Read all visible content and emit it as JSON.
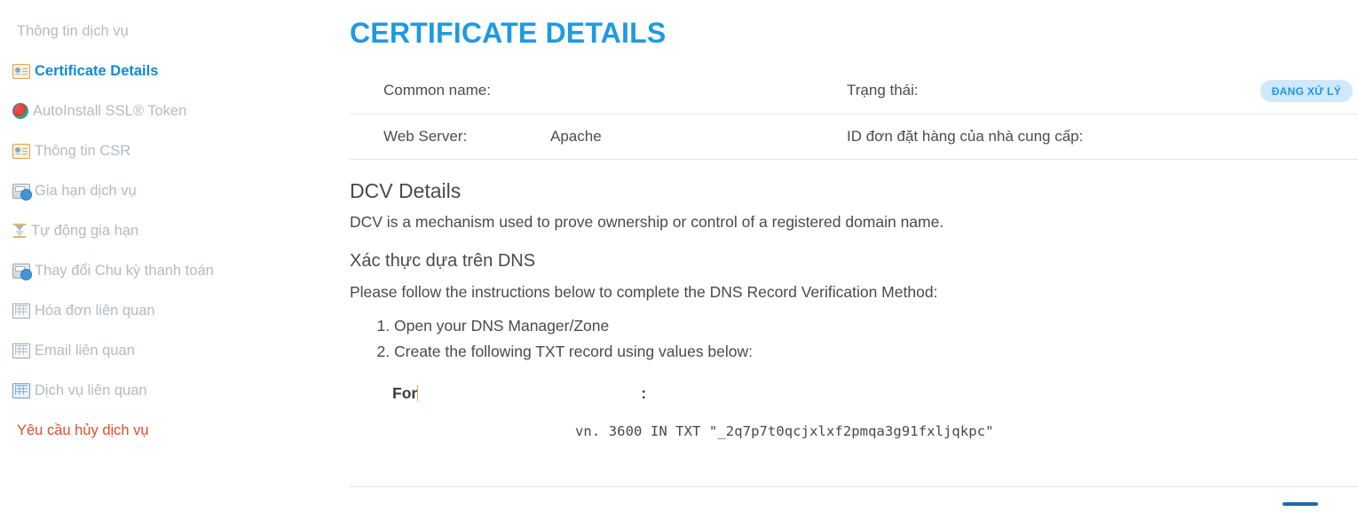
{
  "sidebar": {
    "items": [
      {
        "label": "Thông tin dịch vụ",
        "icon": "none",
        "state": "plain"
      },
      {
        "label": "Certificate Details",
        "icon": "certificate-card-icon",
        "state": "active"
      },
      {
        "label": "AutoInstall SSL® Token",
        "icon": "autoinstall-token-icon",
        "state": "normal"
      },
      {
        "label": "Thông tin CSR",
        "icon": "certificate-card-icon",
        "state": "normal"
      },
      {
        "label": "Gia hạn dịch vụ",
        "icon": "renew-icon",
        "state": "normal"
      },
      {
        "label": "Tự động gia hạn",
        "icon": "hourglass-icon",
        "state": "normal"
      },
      {
        "label": "Thay đổi Chu kỳ thanh toán",
        "icon": "renew-icon",
        "state": "normal"
      },
      {
        "label": "Hóa đơn liên quan",
        "icon": "grid-icon",
        "state": "normal"
      },
      {
        "label": "Email liên quan",
        "icon": "grid-icon",
        "state": "normal"
      },
      {
        "label": "Dịch vụ liên quan",
        "icon": "grid-blue-icon",
        "state": "normal"
      },
      {
        "label": "Yêu cầu hủy dịch vụ",
        "icon": "none",
        "state": "danger"
      }
    ]
  },
  "main": {
    "page_title": "CERTIFICATE DETAILS",
    "info": {
      "common_name_label": "Common name:",
      "common_name_value": "",
      "status_label": "Trạng thái:",
      "status_badge": "ĐANG XỬ LÝ",
      "web_server_label": "Web Server:",
      "web_server_value": "Apache",
      "vendor_order_id_label": "ID đơn đặt hàng của nhà cung cấp:",
      "vendor_order_id_value": ""
    },
    "dcv": {
      "title": "DCV Details",
      "description": "DCV is a mechanism used to prove ownership or control of a registered domain name.",
      "dns_title": "Xác thực dựa trên DNS",
      "dns_description": "Please follow the instructions below to complete the DNS Record Verification Method:",
      "steps": [
        "Open your DNS Manager/Zone",
        "Create the following TXT record using values below:"
      ],
      "for_prefix": "For",
      "for_suffix": ":",
      "txt_record": "vn. 3600 IN TXT \"_2q7p7t0qcjxlxf2pmqa3g91fxljqkpc\""
    }
  },
  "colors": {
    "title_blue": "#1f9ae0",
    "link_blue": "#0d8bd9",
    "muted": "#b3bbc0",
    "danger_red": "#e8492f",
    "badge_bg": "#cfe8fb",
    "badge_fg": "#2196e8"
  }
}
